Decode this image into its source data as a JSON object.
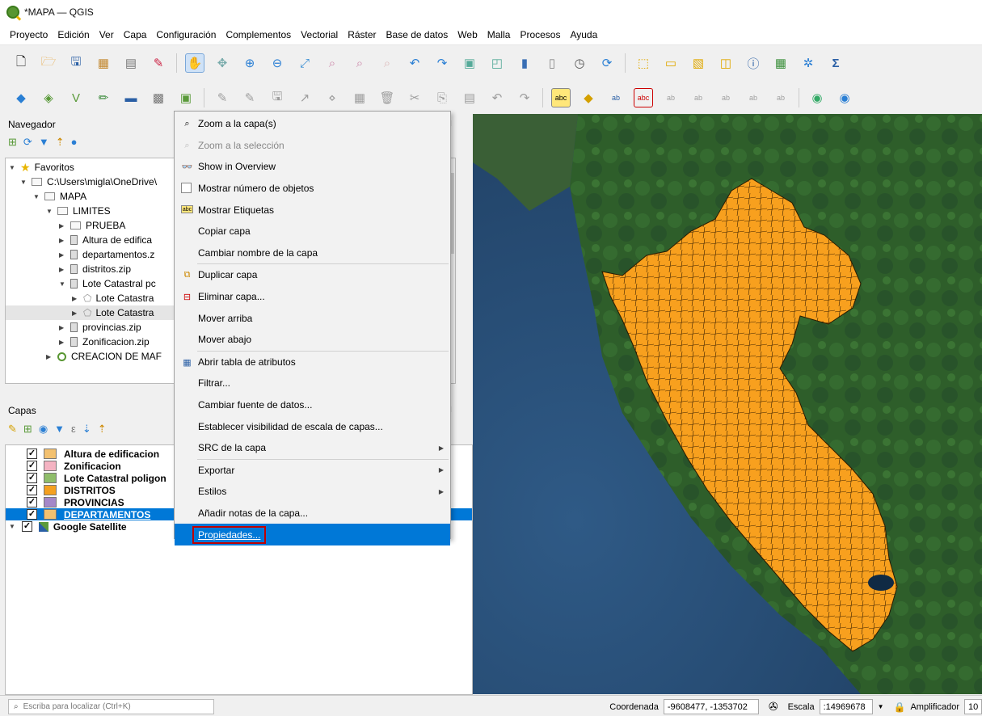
{
  "window": {
    "title": "*MAPA — QGIS"
  },
  "menubar": [
    "Proyecto",
    "Edición",
    "Ver",
    "Capa",
    "Configuración",
    "Complementos",
    "Vectorial",
    "Ráster",
    "Base de datos",
    "Web",
    "Malla",
    "Procesos",
    "Ayuda"
  ],
  "navigator": {
    "title": "Navegador",
    "tree": [
      {
        "label": "Favoritos",
        "level": 0
      },
      {
        "label": "C:\\Users\\migla\\OneDrive\\",
        "level": 1
      },
      {
        "label": "MAPA",
        "level": 2
      },
      {
        "label": "LIMITES",
        "level": 3
      },
      {
        "label": "PRUEBA",
        "level": 4
      },
      {
        "label": "Altura de edifica",
        "level": 4
      },
      {
        "label": "departamentos.z",
        "level": 4
      },
      {
        "label": "distritos.zip",
        "level": 4
      },
      {
        "label": "Lote Catastral pc",
        "level": 4
      },
      {
        "label": "Lote Catastra",
        "level": 5
      },
      {
        "label": "Lote Catastra",
        "level": 5
      },
      {
        "label": "provincias.zip",
        "level": 4
      },
      {
        "label": "Zonificacion.zip",
        "level": 4
      },
      {
        "label": "CREACION DE MAF",
        "level": 3
      }
    ]
  },
  "layers_panel": {
    "title": "Capas",
    "layers": [
      {
        "name": "Altura de edificacion",
        "color": "#f3c170"
      },
      {
        "name": "Zonificacion",
        "color": "#f4b3c2"
      },
      {
        "name": "Lote Catastral poligon",
        "color": "#8fbd6a"
      },
      {
        "name": "DISTRITOS",
        "color": "#f4a020"
      },
      {
        "name": "PROVINCIAS",
        "color": "#a487c9"
      },
      {
        "name": "DEPARTAMENTOS",
        "color": "#f3c170"
      },
      {
        "name": "Google Satellite",
        "color": ""
      }
    ]
  },
  "context_menu": {
    "items": [
      {
        "label": "Zoom a la capa(s)",
        "icon": "zoom-layer-icon",
        "disabled": false
      },
      {
        "label": "Zoom a la selección",
        "icon": "zoom-selection-icon",
        "disabled": true
      },
      {
        "label": "Show in Overview",
        "icon": "overview-icon",
        "disabled": false
      },
      {
        "label": "Mostrar número de objetos",
        "icon": "checkbox-icon",
        "disabled": false
      },
      {
        "label": "Mostrar Etiquetas",
        "icon": "labels-icon",
        "disabled": false
      },
      {
        "label": "Copiar capa",
        "icon": "",
        "disabled": false
      },
      {
        "label": "Cambiar nombre de la capa",
        "icon": "",
        "disabled": false
      },
      {
        "label": "Duplicar capa",
        "icon": "duplicate-icon",
        "disabled": false
      },
      {
        "label": "Eliminar capa...",
        "icon": "remove-layer-icon",
        "disabled": false
      },
      {
        "label": "Mover arriba",
        "icon": "",
        "disabled": false
      },
      {
        "label": "Mover abajo",
        "icon": "",
        "disabled": false
      },
      {
        "label": "Abrir tabla de atributos",
        "icon": "table-icon",
        "disabled": false
      },
      {
        "label": "Filtrar...",
        "icon": "",
        "disabled": false
      },
      {
        "label": "Cambiar fuente de datos...",
        "icon": "",
        "disabled": false
      },
      {
        "label": "Establecer visibilidad de escala de capas...",
        "icon": "",
        "disabled": false
      },
      {
        "label": "SRC de la capa",
        "icon": "",
        "disabled": false
      },
      {
        "label": "Exportar",
        "icon": "",
        "disabled": false
      },
      {
        "label": "Estilos",
        "icon": "",
        "disabled": false
      },
      {
        "label": "Añadir notas de la capa...",
        "icon": "",
        "disabled": false
      },
      {
        "label": "Propiedades...",
        "icon": "",
        "disabled": false
      }
    ]
  },
  "statusbar": {
    "locator_placeholder": "Escriba para localizar (Ctrl+K)",
    "coord_label": "Coordenada",
    "coord_value": "-9608477, -1353702",
    "scale_label": "Escala",
    "scale_value": ":14969678",
    "magnifier_label": "Amplificador",
    "magnifier_value": "10"
  }
}
